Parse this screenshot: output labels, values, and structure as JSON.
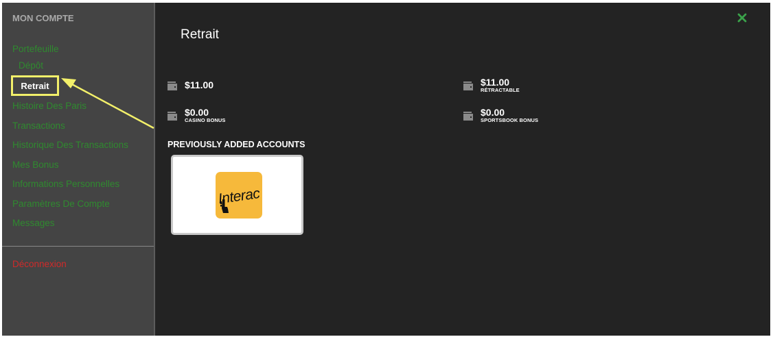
{
  "sidebar": {
    "title": "MON COMPTE",
    "items": [
      {
        "label": "Portefeuille"
      },
      {
        "label": "Dépôt"
      },
      {
        "label": "Retrait"
      },
      {
        "label": "Histoire Des Paris"
      },
      {
        "label": "Transactions"
      },
      {
        "label": "Historique Des Transactions"
      },
      {
        "label": "Mes Bonus"
      },
      {
        "label": "Informations Personnelles"
      },
      {
        "label": "Paramètres De Compte"
      },
      {
        "label": "Messages"
      }
    ],
    "active_item": "Retrait",
    "logout_label": "Déconnexion"
  },
  "main": {
    "title": "Retrait",
    "balances": [
      {
        "amount": "$11.00",
        "label": ""
      },
      {
        "amount": "$11.00",
        "label": "RÉTRACTABLE"
      },
      {
        "amount": "$0.00",
        "label": "CASINO BONUS"
      },
      {
        "amount": "$0.00",
        "label": "SPORTSBOOK BONUS"
      }
    ],
    "accounts_heading": "PREVIOUSLY ADDED ACCOUNTS",
    "accounts": [
      {
        "brand": "Interac"
      }
    ]
  },
  "colors": {
    "panel_bg": "#232323",
    "sidebar_bg": "#444444",
    "nav_green": "#2f8a2f",
    "logout_red": "#d12a2a",
    "highlight_yellow": "#f3f06a",
    "close_green": "#3aa24a",
    "interac_yellow": "#f6b93b"
  },
  "icons": {
    "close": "close-icon",
    "wallet": "wallet-icon",
    "annotation": "arrow-annotation"
  }
}
